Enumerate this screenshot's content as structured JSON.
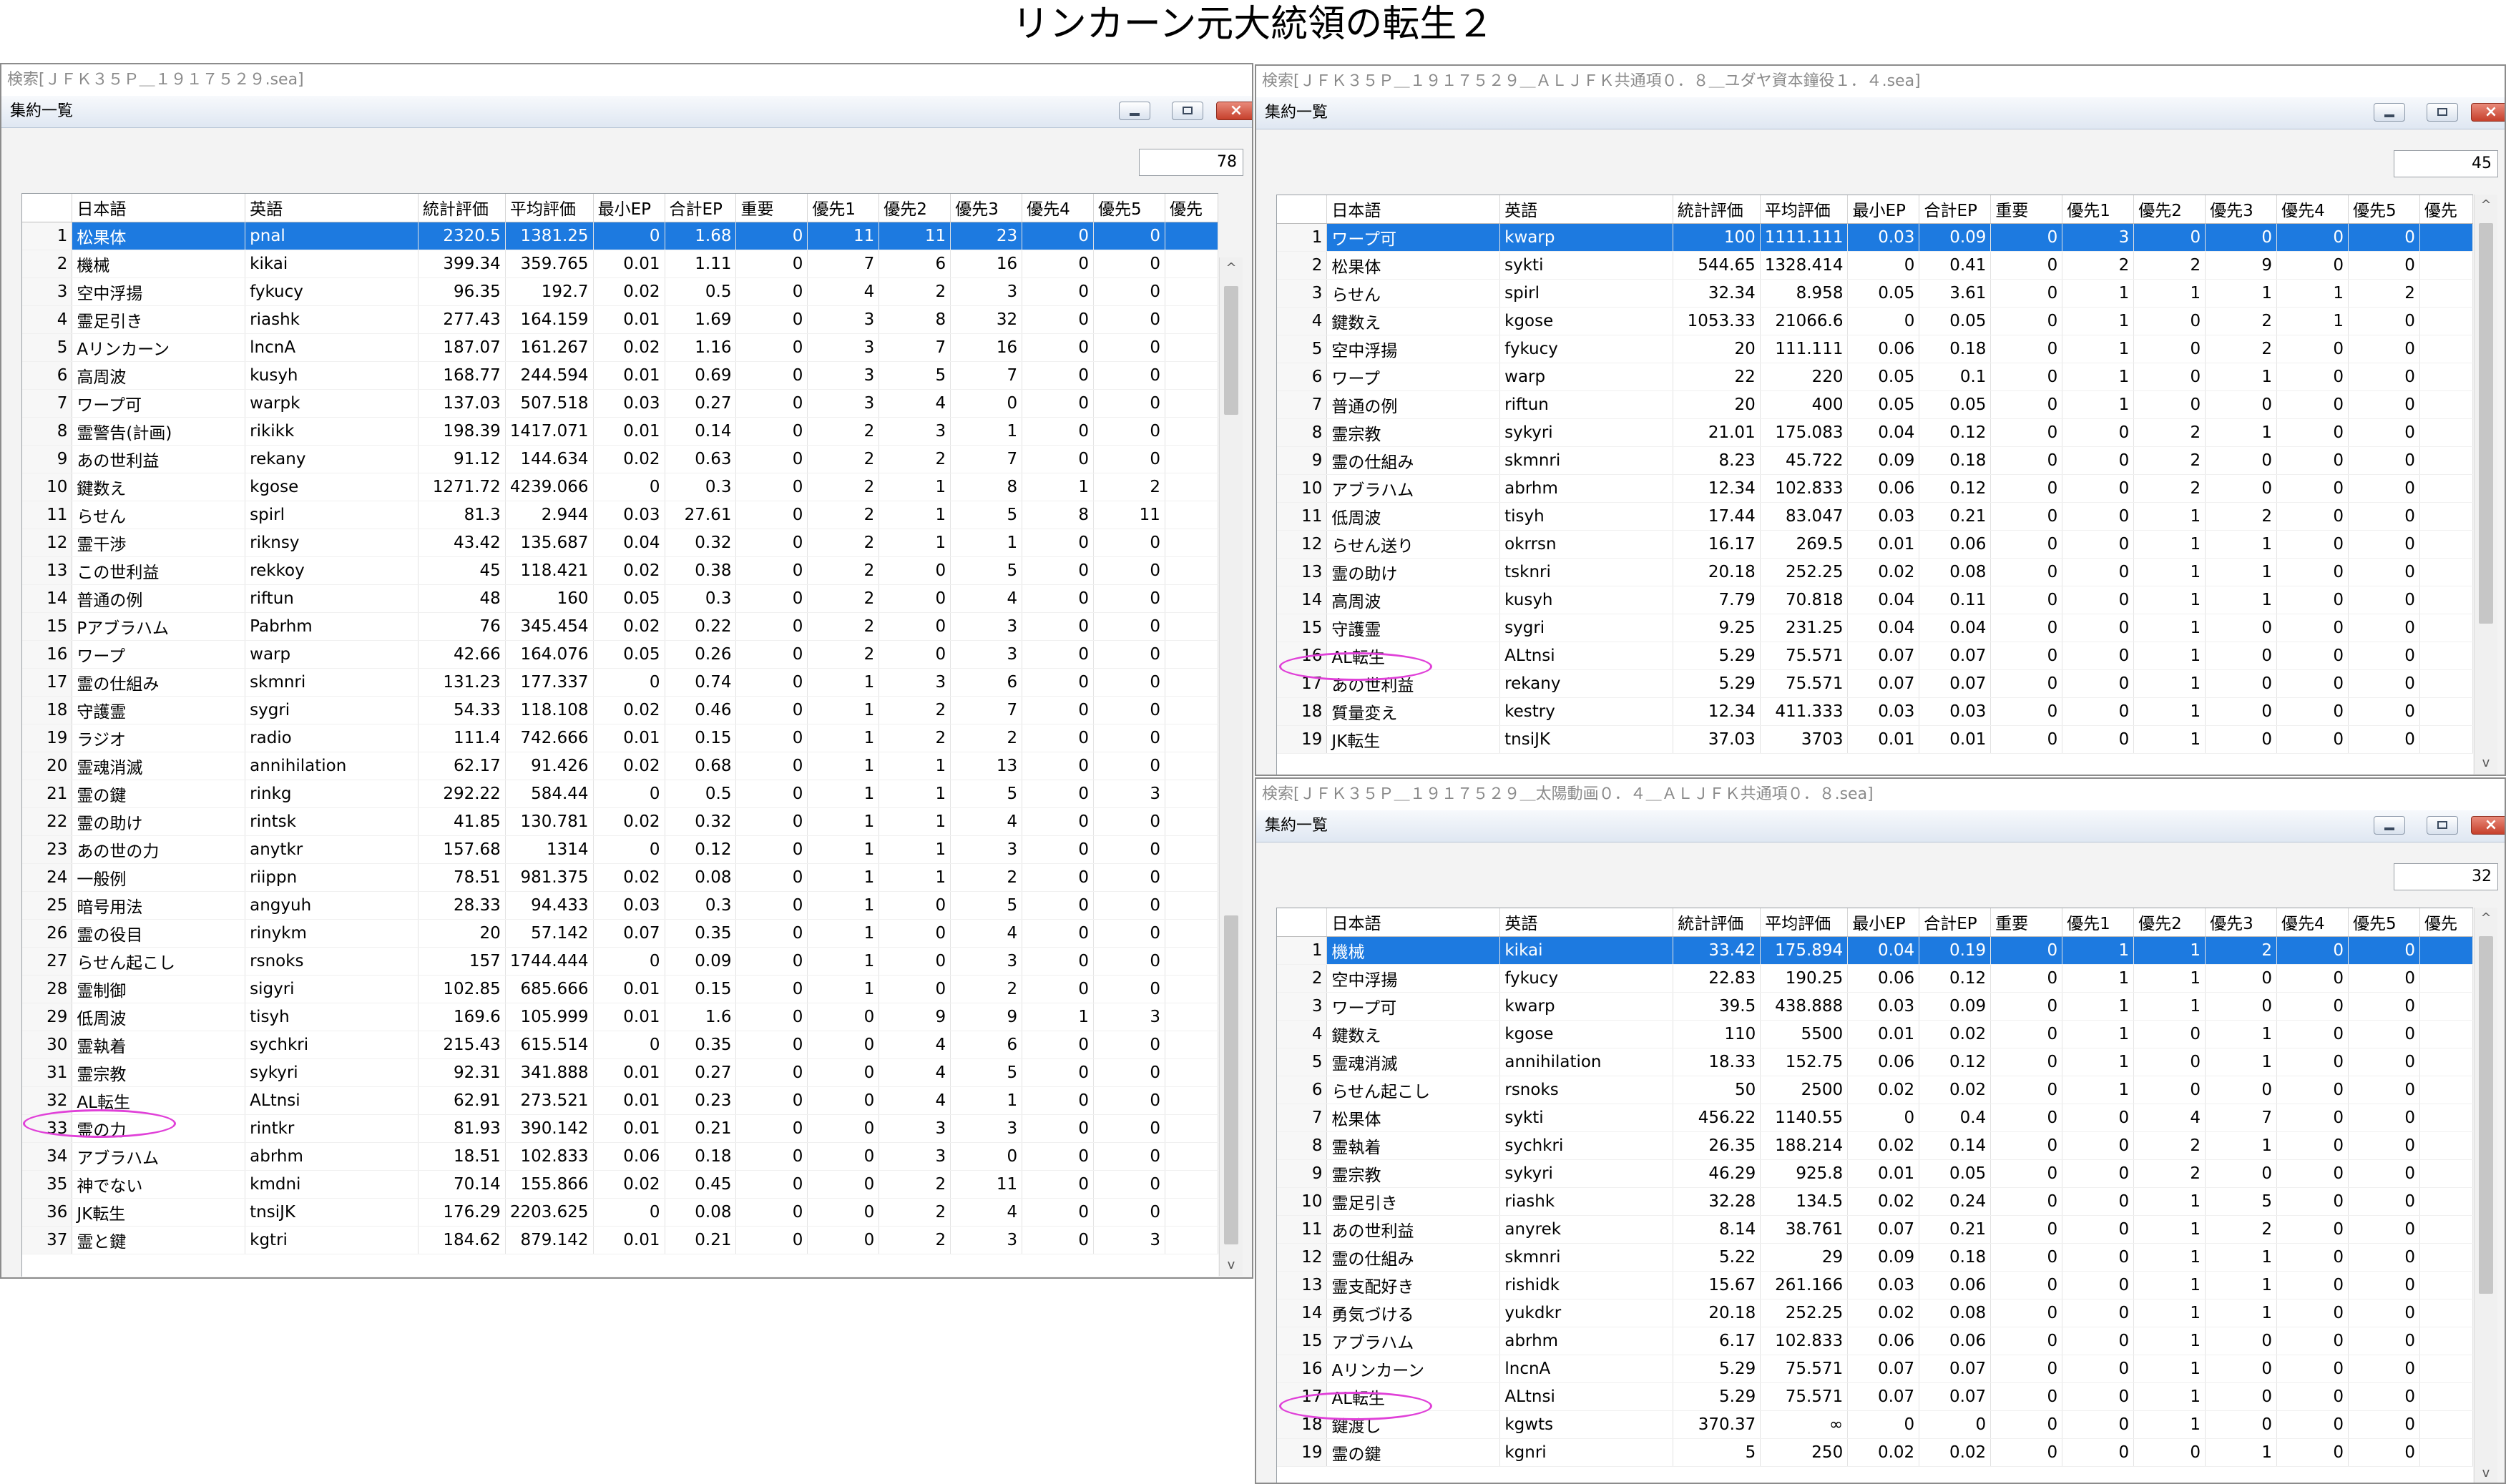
{
  "page_title": "リンカーン元大統領の転生２",
  "columns": [
    "日本語",
    "英語",
    "統計評価",
    "平均評価",
    "最小EP",
    "合計EP",
    "重要",
    "優先1",
    "優先2",
    "優先3",
    "優先4",
    "優先5",
    "優先"
  ],
  "windows": [
    {
      "search": "検索[ＪＦＫ３５Ｐ＿１９１７５２９.sea]",
      "panel_title": "集約一覧",
      "count": "78",
      "rows": [
        [
          "1",
          "松果体",
          "pnal",
          "2320.5",
          "1381.25",
          "0",
          "1.68",
          "0",
          "11",
          "11",
          "23",
          "0",
          "0"
        ],
        [
          "2",
          "機械",
          "kikai",
          "399.34",
          "359.765",
          "0.01",
          "1.11",
          "0",
          "7",
          "6",
          "16",
          "0",
          "0"
        ],
        [
          "3",
          "空中浮揚",
          "fykucy",
          "96.35",
          "192.7",
          "0.02",
          "0.5",
          "0",
          "4",
          "2",
          "3",
          "0",
          "0"
        ],
        [
          "4",
          "霊足引き",
          "riashk",
          "277.43",
          "164.159",
          "0.01",
          "1.69",
          "0",
          "3",
          "8",
          "32",
          "0",
          "0"
        ],
        [
          "5",
          "Aリンカーン",
          "lncnA",
          "187.07",
          "161.267",
          "0.02",
          "1.16",
          "0",
          "3",
          "7",
          "16",
          "0",
          "0"
        ],
        [
          "6",
          "高周波",
          "kusyh",
          "168.77",
          "244.594",
          "0.01",
          "0.69",
          "0",
          "3",
          "5",
          "7",
          "0",
          "0"
        ],
        [
          "7",
          "ワープ可",
          "warpk",
          "137.03",
          "507.518",
          "0.03",
          "0.27",
          "0",
          "3",
          "4",
          "0",
          "0",
          "0"
        ],
        [
          "8",
          "霊警告(計画)",
          "rikikk",
          "198.39",
          "1417.071",
          "0.01",
          "0.14",
          "0",
          "2",
          "3",
          "1",
          "0",
          "0"
        ],
        [
          "9",
          "あの世利益",
          "rekany",
          "91.12",
          "144.634",
          "0.02",
          "0.63",
          "0",
          "2",
          "2",
          "7",
          "0",
          "0"
        ],
        [
          "10",
          "鍵数え",
          "kgose",
          "1271.72",
          "4239.066",
          "0",
          "0.3",
          "0",
          "2",
          "1",
          "8",
          "1",
          "2"
        ],
        [
          "11",
          "らせん",
          "spirl",
          "81.3",
          "2.944",
          "0.03",
          "27.61",
          "0",
          "2",
          "1",
          "5",
          "8",
          "11"
        ],
        [
          "12",
          "霊干渉",
          "riknsy",
          "43.42",
          "135.687",
          "0.04",
          "0.32",
          "0",
          "2",
          "1",
          "1",
          "0",
          "0"
        ],
        [
          "13",
          "この世利益",
          "rekkoy",
          "45",
          "118.421",
          "0.02",
          "0.38",
          "0",
          "2",
          "0",
          "5",
          "0",
          "0"
        ],
        [
          "14",
          "普通の例",
          "riftun",
          "48",
          "160",
          "0.05",
          "0.3",
          "0",
          "2",
          "0",
          "4",
          "0",
          "0"
        ],
        [
          "15",
          "Pアブラハム",
          "Pabrhm",
          "76",
          "345.454",
          "0.02",
          "0.22",
          "0",
          "2",
          "0",
          "3",
          "0",
          "0"
        ],
        [
          "16",
          "ワープ",
          "warp",
          "42.66",
          "164.076",
          "0.05",
          "0.26",
          "0",
          "2",
          "0",
          "3",
          "0",
          "0"
        ],
        [
          "17",
          "霊の仕組み",
          "skmnri",
          "131.23",
          "177.337",
          "0",
          "0.74",
          "0",
          "1",
          "3",
          "6",
          "0",
          "0"
        ],
        [
          "18",
          "守護霊",
          "sygri",
          "54.33",
          "118.108",
          "0.02",
          "0.46",
          "0",
          "1",
          "2",
          "7",
          "0",
          "0"
        ],
        [
          "19",
          "ラジオ",
          "radio",
          "111.4",
          "742.666",
          "0.01",
          "0.15",
          "0",
          "1",
          "2",
          "2",
          "0",
          "0"
        ],
        [
          "20",
          "霊魂消滅",
          "annihilation",
          "62.17",
          "91.426",
          "0.02",
          "0.68",
          "0",
          "1",
          "1",
          "13",
          "0",
          "0"
        ],
        [
          "21",
          "霊の鍵",
          "rinkg",
          "292.22",
          "584.44",
          "0",
          "0.5",
          "0",
          "1",
          "1",
          "5",
          "0",
          "3"
        ],
        [
          "22",
          "霊の助け",
          "rintsk",
          "41.85",
          "130.781",
          "0.02",
          "0.32",
          "0",
          "1",
          "1",
          "4",
          "0",
          "0"
        ],
        [
          "23",
          "あの世の力",
          "anytkr",
          "157.68",
          "1314",
          "0",
          "0.12",
          "0",
          "1",
          "1",
          "3",
          "0",
          "0"
        ],
        [
          "24",
          "一般例",
          "riippn",
          "78.51",
          "981.375",
          "0.02",
          "0.08",
          "0",
          "1",
          "1",
          "2",
          "0",
          "0"
        ],
        [
          "25",
          "暗号用法",
          "angyuh",
          "28.33",
          "94.433",
          "0.03",
          "0.3",
          "0",
          "1",
          "0",
          "5",
          "0",
          "0"
        ],
        [
          "26",
          "霊の役目",
          "rinykm",
          "20",
          "57.142",
          "0.07",
          "0.35",
          "0",
          "1",
          "0",
          "4",
          "0",
          "0"
        ],
        [
          "27",
          "らせん起こし",
          "rsnoks",
          "157",
          "1744.444",
          "0",
          "0.09",
          "0",
          "1",
          "0",
          "3",
          "0",
          "0"
        ],
        [
          "28",
          "霊制御",
          "sigyri",
          "102.85",
          "685.666",
          "0.01",
          "0.15",
          "0",
          "1",
          "0",
          "2",
          "0",
          "0"
        ],
        [
          "29",
          "低周波",
          "tisyh",
          "169.6",
          "105.999",
          "0.01",
          "1.6",
          "0",
          "0",
          "9",
          "9",
          "1",
          "3"
        ],
        [
          "30",
          "霊執着",
          "sychkri",
          "215.43",
          "615.514",
          "0",
          "0.35",
          "0",
          "0",
          "4",
          "6",
          "0",
          "0"
        ],
        [
          "31",
          "霊宗教",
          "sykyri",
          "92.31",
          "341.888",
          "0.01",
          "0.27",
          "0",
          "0",
          "4",
          "5",
          "0",
          "0"
        ],
        [
          "32",
          "AL転生",
          "ALtnsi",
          "62.91",
          "273.521",
          "0.01",
          "0.23",
          "0",
          "0",
          "4",
          "1",
          "0",
          "0"
        ],
        [
          "33",
          "霊の力",
          "rintkr",
          "81.93",
          "390.142",
          "0.01",
          "0.21",
          "0",
          "0",
          "3",
          "3",
          "0",
          "0"
        ],
        [
          "34",
          "アブラハム",
          "abrhm",
          "18.51",
          "102.833",
          "0.06",
          "0.18",
          "0",
          "0",
          "3",
          "0",
          "0",
          "0"
        ],
        [
          "35",
          "神でない",
          "kmdni",
          "70.14",
          "155.866",
          "0.02",
          "0.45",
          "0",
          "0",
          "2",
          "11",
          "0",
          "0"
        ],
        [
          "36",
          "JK転生",
          "tnsiJK",
          "176.29",
          "2203.625",
          "0",
          "0.08",
          "0",
          "0",
          "2",
          "4",
          "0",
          "0"
        ],
        [
          "37",
          "霊と鍵",
          "kgtri",
          "184.62",
          "879.142",
          "0.01",
          "0.21",
          "0",
          "0",
          "2",
          "3",
          "0",
          "3"
        ]
      ]
    },
    {
      "search": "検索[ＪＦＫ３５Ｐ＿１９１７５２９＿ＡＬＪＦＫ共通項０．８＿ユダヤ資本鐘役１．４.sea]",
      "panel_title": "集約一覧",
      "count": "45",
      "rows": [
        [
          "1",
          "ワープ可",
          "kwarp",
          "100",
          "1111.111",
          "0.03",
          "0.09",
          "0",
          "3",
          "0",
          "0",
          "0",
          "0"
        ],
        [
          "2",
          "松果体",
          "sykti",
          "544.65",
          "1328.414",
          "0",
          "0.41",
          "0",
          "2",
          "2",
          "9",
          "0",
          "0"
        ],
        [
          "3",
          "らせん",
          "spirl",
          "32.34",
          "8.958",
          "0.05",
          "3.61",
          "0",
          "1",
          "1",
          "1",
          "1",
          "2"
        ],
        [
          "4",
          "鍵数え",
          "kgose",
          "1053.33",
          "21066.6",
          "0",
          "0.05",
          "0",
          "1",
          "0",
          "2",
          "1",
          "0"
        ],
        [
          "5",
          "空中浮揚",
          "fykucy",
          "20",
          "111.111",
          "0.06",
          "0.18",
          "0",
          "1",
          "0",
          "2",
          "0",
          "0"
        ],
        [
          "6",
          "ワープ",
          "warp",
          "22",
          "220",
          "0.05",
          "0.1",
          "0",
          "1",
          "0",
          "1",
          "0",
          "0"
        ],
        [
          "7",
          "普通の例",
          "riftun",
          "20",
          "400",
          "0.05",
          "0.05",
          "0",
          "1",
          "0",
          "0",
          "0",
          "0"
        ],
        [
          "8",
          "霊宗教",
          "sykyri",
          "21.01",
          "175.083",
          "0.04",
          "0.12",
          "0",
          "0",
          "2",
          "1",
          "0",
          "0"
        ],
        [
          "9",
          "霊の仕組み",
          "skmnri",
          "8.23",
          "45.722",
          "0.09",
          "0.18",
          "0",
          "0",
          "2",
          "0",
          "0",
          "0"
        ],
        [
          "10",
          "アブラハム",
          "abrhm",
          "12.34",
          "102.833",
          "0.06",
          "0.12",
          "0",
          "0",
          "2",
          "0",
          "0",
          "0"
        ],
        [
          "11",
          "低周波",
          "tisyh",
          "17.44",
          "83.047",
          "0.03",
          "0.21",
          "0",
          "0",
          "1",
          "2",
          "0",
          "0"
        ],
        [
          "12",
          "らせん送り",
          "okrrsn",
          "16.17",
          "269.5",
          "0.01",
          "0.06",
          "0",
          "0",
          "1",
          "1",
          "0",
          "0"
        ],
        [
          "13",
          "霊の助け",
          "tsknri",
          "20.18",
          "252.25",
          "0.02",
          "0.08",
          "0",
          "0",
          "1",
          "1",
          "0",
          "0"
        ],
        [
          "14",
          "高周波",
          "kusyh",
          "7.79",
          "70.818",
          "0.04",
          "0.11",
          "0",
          "0",
          "1",
          "1",
          "0",
          "0"
        ],
        [
          "15",
          "守護霊",
          "sygri",
          "9.25",
          "231.25",
          "0.04",
          "0.04",
          "0",
          "0",
          "1",
          "0",
          "0",
          "0"
        ],
        [
          "16",
          "AL転生",
          "ALtnsi",
          "5.29",
          "75.571",
          "0.07",
          "0.07",
          "0",
          "0",
          "1",
          "0",
          "0",
          "0"
        ],
        [
          "17",
          "あの世利益",
          "rekany",
          "5.29",
          "75.571",
          "0.07",
          "0.07",
          "0",
          "0",
          "1",
          "0",
          "0",
          "0"
        ],
        [
          "18",
          "質量変え",
          "kestry",
          "12.34",
          "411.333",
          "0.03",
          "0.03",
          "0",
          "0",
          "1",
          "0",
          "0",
          "0"
        ],
        [
          "19",
          "JK転生",
          "tnsiJK",
          "37.03",
          "3703",
          "0.01",
          "0.01",
          "0",
          "0",
          "1",
          "0",
          "0",
          "0"
        ]
      ]
    },
    {
      "search": "検索[ＪＦＫ３５Ｐ＿１９１７５２９＿太陽動画０．４＿ＡＬＪＦＫ共通項０．８.sea]",
      "panel_title": "集約一覧",
      "count": "32",
      "rows": [
        [
          "1",
          "機械",
          "kikai",
          "33.42",
          "175.894",
          "0.04",
          "0.19",
          "0",
          "1",
          "1",
          "2",
          "0",
          "0"
        ],
        [
          "2",
          "空中浮揚",
          "fykucy",
          "22.83",
          "190.25",
          "0.06",
          "0.12",
          "0",
          "1",
          "1",
          "0",
          "0",
          "0"
        ],
        [
          "3",
          "ワープ可",
          "kwarp",
          "39.5",
          "438.888",
          "0.03",
          "0.09",
          "0",
          "1",
          "1",
          "0",
          "0",
          "0"
        ],
        [
          "4",
          "鍵数え",
          "kgose",
          "110",
          "5500",
          "0.01",
          "0.02",
          "0",
          "1",
          "0",
          "1",
          "0",
          "0"
        ],
        [
          "5",
          "霊魂消滅",
          "annihilation",
          "18.33",
          "152.75",
          "0.06",
          "0.12",
          "0",
          "1",
          "0",
          "1",
          "0",
          "0"
        ],
        [
          "6",
          "らせん起こし",
          "rsnoks",
          "50",
          "2500",
          "0.02",
          "0.02",
          "0",
          "1",
          "0",
          "0",
          "0",
          "0"
        ],
        [
          "7",
          "松果体",
          "sykti",
          "456.22",
          "1140.55",
          "0",
          "0.4",
          "0",
          "0",
          "4",
          "7",
          "0",
          "0"
        ],
        [
          "8",
          "霊執着",
          "sychkri",
          "26.35",
          "188.214",
          "0.02",
          "0.14",
          "0",
          "0",
          "2",
          "1",
          "0",
          "0"
        ],
        [
          "9",
          "霊宗教",
          "sykyri",
          "46.29",
          "925.8",
          "0.01",
          "0.05",
          "0",
          "0",
          "2",
          "0",
          "0",
          "0"
        ],
        [
          "10",
          "霊足引き",
          "riashk",
          "32.28",
          "134.5",
          "0.02",
          "0.24",
          "0",
          "0",
          "1",
          "5",
          "0",
          "0"
        ],
        [
          "11",
          "あの世利益",
          "anyrek",
          "8.14",
          "38.761",
          "0.07",
          "0.21",
          "0",
          "0",
          "1",
          "2",
          "0",
          "0"
        ],
        [
          "12",
          "霊の仕組み",
          "skmnri",
          "5.22",
          "29",
          "0.09",
          "0.18",
          "0",
          "0",
          "1",
          "1",
          "0",
          "0"
        ],
        [
          "13",
          "霊支配好き",
          "rishidk",
          "15.67",
          "261.166",
          "0.03",
          "0.06",
          "0",
          "0",
          "1",
          "1",
          "0",
          "0"
        ],
        [
          "14",
          "勇気づける",
          "yukdkr",
          "20.18",
          "252.25",
          "0.02",
          "0.08",
          "0",
          "0",
          "1",
          "1",
          "0",
          "0"
        ],
        [
          "15",
          "アブラハム",
          "abrhm",
          "6.17",
          "102.833",
          "0.06",
          "0.06",
          "0",
          "0",
          "1",
          "0",
          "0",
          "0"
        ],
        [
          "16",
          "Aリンカーン",
          "lncnA",
          "5.29",
          "75.571",
          "0.07",
          "0.07",
          "0",
          "0",
          "1",
          "0",
          "0",
          "0"
        ],
        [
          "17",
          "AL転生",
          "ALtnsi",
          "5.29",
          "75.571",
          "0.07",
          "0.07",
          "0",
          "0",
          "1",
          "0",
          "0",
          "0"
        ],
        [
          "18",
          "鍵渡し",
          "kgwts",
          "370.37",
          "∞",
          "0",
          "0",
          "0",
          "0",
          "1",
          "0",
          "0",
          "0"
        ],
        [
          "19",
          "霊の鍵",
          "kgnri",
          "5",
          "250",
          "0.02",
          "0.02",
          "0",
          "0",
          "0",
          "1",
          "0",
          "0"
        ]
      ]
    }
  ],
  "icons": {
    "minimize": "minimize-icon",
    "maximize": "maximize-icon",
    "close": "close-icon",
    "scroll_up": "chevron-up-icon",
    "scroll_down": "chevron-down-icon"
  },
  "colors": {
    "selection": "#1d7ae0",
    "highlight_oval": "#e040d8",
    "close_button": "#c6402c"
  },
  "close_glyph": "×",
  "up_glyph": "^",
  "down_glyph": "v"
}
